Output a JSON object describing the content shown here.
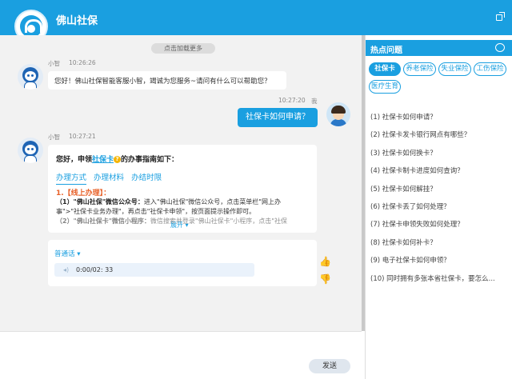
{
  "app": {
    "title": "佛山社保"
  },
  "chat": {
    "load_more": "点击加载更多",
    "messages": [
      {
        "sender": "小智",
        "time": "10:26:26",
        "text": "您好！佛山社保智能客服小智，竭诚为您服务~请问有什么可以帮助您？"
      },
      {
        "sender": "我",
        "time": "10:27:20",
        "text": "社保卡如何申请？"
      },
      {
        "sender": "小智",
        "time": "10:27:21"
      }
    ],
    "answer_card": {
      "title_prefix": "您好，申领",
      "title_link": "社保卡",
      "title_suffix": "的办事指南如下：",
      "tabs": [
        "办理方式",
        "办理材料",
        "办结时限"
      ],
      "section_title": "1.【线上办理】：",
      "lines": [
        {
          "bold": "（1）\"佛山社保\"微信公众号：",
          "text": "进入\"佛山社保\"微信公众号，点击菜单栏\"网上办"
        },
        {
          "bold": "",
          "text": "事\">\"社保卡业务办理\"，再点击\"社保卡申领\"，按页面提示操作即可。"
        },
        {
          "bold": "（2）\"佛山社保卡\"微信小程序：",
          "text": "微信搜索并登录\"佛山社保卡\"小程序，点击\"社保"
        }
      ],
      "expand": "展开"
    },
    "audio": {
      "label": "普通话",
      "time": "0:00/02: 33"
    }
  },
  "input": {
    "send_label": "发送"
  },
  "panel": {
    "title": "热点问题",
    "tags": [
      "社保卡",
      "养老保险",
      "失业保险",
      "工伤保险",
      "医疗生育"
    ],
    "questions": [
      "(1) 社保卡如何申请？",
      "(2) 社保卡发卡银行网点有哪些？",
      "(3) 社保卡如何换卡？",
      "(4) 社保卡制卡进度如何查询？",
      "(5) 社保卡如何解挂？",
      "(6) 社保卡丢了如何处理？",
      "(7) 社保卡申领失败如何处理？",
      "(8) 社保卡如何补卡？",
      "(9) 电子社保卡如何申领？",
      "(10) 同时拥有多张本省社保卡，要怎么..."
    ]
  },
  "colors": {
    "accent": "#1a9fe0",
    "section_orange": "#e8622a"
  }
}
